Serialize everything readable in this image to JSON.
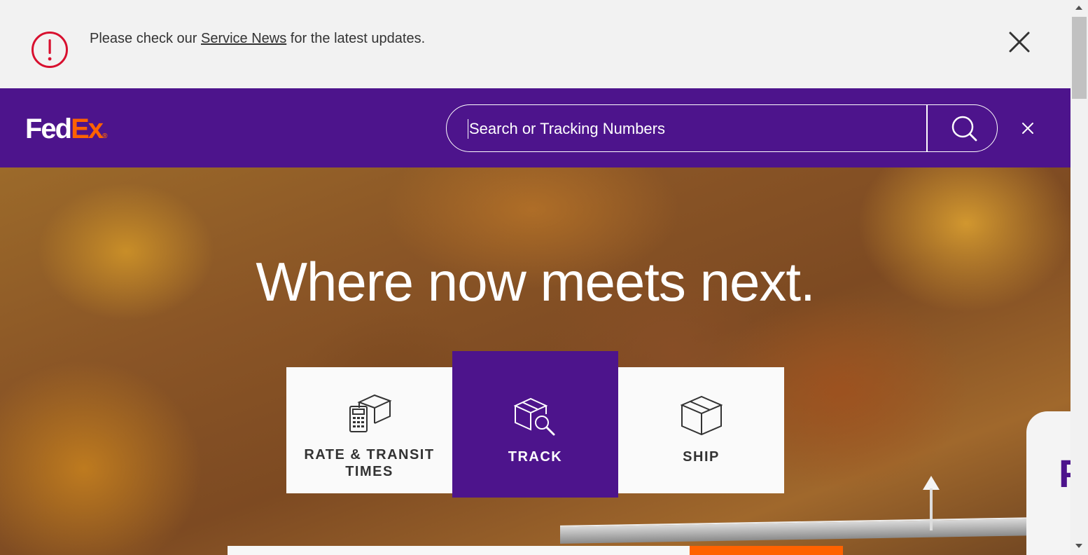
{
  "alert": {
    "prefix": "Please check our ",
    "link": "Service News",
    "suffix": " for the latest updates.",
    "icon": "alert-circle-icon",
    "close_icon": "close-icon",
    "icon_color": "#d8102f"
  },
  "header": {
    "logo": {
      "fed": "Fed",
      "ex": "Ex",
      "reg": "®"
    },
    "search": {
      "placeholder": "Search or Tracking Numbers",
      "value": ""
    },
    "search_icon": "search-icon",
    "close_icon": "close-icon",
    "brand_color": "#4d148c",
    "accent_color": "#ff6200"
  },
  "hero": {
    "title": "Where now meets next.",
    "van_mark": "F"
  },
  "actions": [
    {
      "label": "RATE & TRANSIT TIMES",
      "label_line1": "RATE & TRANSIT",
      "label_line2": "TIMES",
      "icon": "calculator-box-icon"
    },
    {
      "label": "TRACK",
      "icon": "box-magnifier-icon",
      "active": true
    },
    {
      "label": "SHIP",
      "icon": "box-icon"
    }
  ]
}
